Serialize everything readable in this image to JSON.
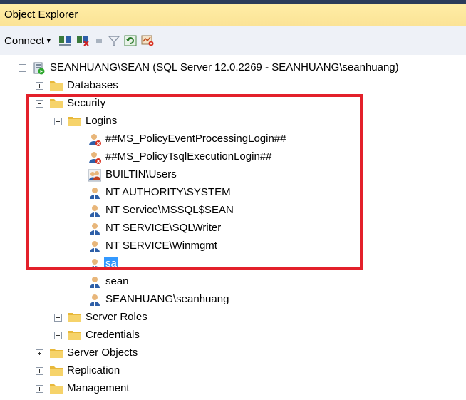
{
  "panel": {
    "title": "Object Explorer"
  },
  "toolbar": {
    "connect_label": "Connect",
    "icons": [
      "connect-object-explorer-icon",
      "disconnect-icon",
      "stop-icon",
      "filter-icon",
      "refresh-icon",
      "activity-monitor-icon"
    ]
  },
  "tree": {
    "server": {
      "label": "SEANHUANG\\SEAN (SQL Server 12.0.2269 - SEANHUANG\\seanhuang)"
    },
    "databases": {
      "label": "Databases"
    },
    "security": {
      "label": "Security",
      "logins": {
        "label": "Logins",
        "items": [
          {
            "label": "##MS_PolicyEventProcessingLogin##",
            "icon": "disabled-login-icon"
          },
          {
            "label": "##MS_PolicyTsqlExecutionLogin##",
            "icon": "disabled-login-icon"
          },
          {
            "label": "BUILTIN\\Users",
            "icon": "group-login-icon"
          },
          {
            "label": "NT AUTHORITY\\SYSTEM",
            "icon": "login-icon"
          },
          {
            "label": "NT Service\\MSSQL$SEAN",
            "icon": "login-icon"
          },
          {
            "label": "NT SERVICE\\SQLWriter",
            "icon": "login-icon"
          },
          {
            "label": "NT SERVICE\\Winmgmt",
            "icon": "login-icon"
          },
          {
            "label": "sa",
            "icon": "login-icon",
            "selected": true
          },
          {
            "label": "sean",
            "icon": "login-icon"
          },
          {
            "label": "SEANHUANG\\seanhuang",
            "icon": "login-icon"
          }
        ]
      },
      "server_roles": {
        "label": "Server Roles"
      },
      "credentials": {
        "label": "Credentials"
      }
    },
    "server_objects": {
      "label": "Server Objects"
    },
    "replication": {
      "label": "Replication"
    },
    "management": {
      "label": "Management"
    }
  },
  "colors": {
    "highlight_box": "#e3202a",
    "selection": "#3399ff",
    "folder": "#f0c050"
  }
}
